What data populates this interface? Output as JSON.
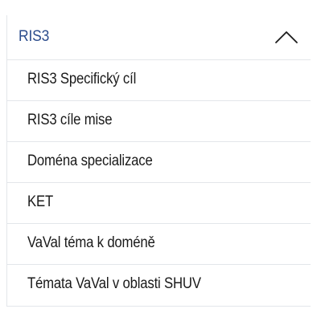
{
  "section": {
    "title": "RIS3",
    "toggle_icon": "chevron-up-icon",
    "colors": {
      "title": "#2b4c8c",
      "item_text": "#1a1a1a",
      "divider": "#e3e6ea"
    },
    "items": [
      {
        "label": "RIS3 Specifický cíl"
      },
      {
        "label": "RIS3 cíle mise"
      },
      {
        "label": "Doména specializace"
      },
      {
        "label": "KET"
      },
      {
        "label": "VaVal téma k doméně"
      },
      {
        "label": "Témata VaVal v oblasti SHUV"
      }
    ]
  }
}
